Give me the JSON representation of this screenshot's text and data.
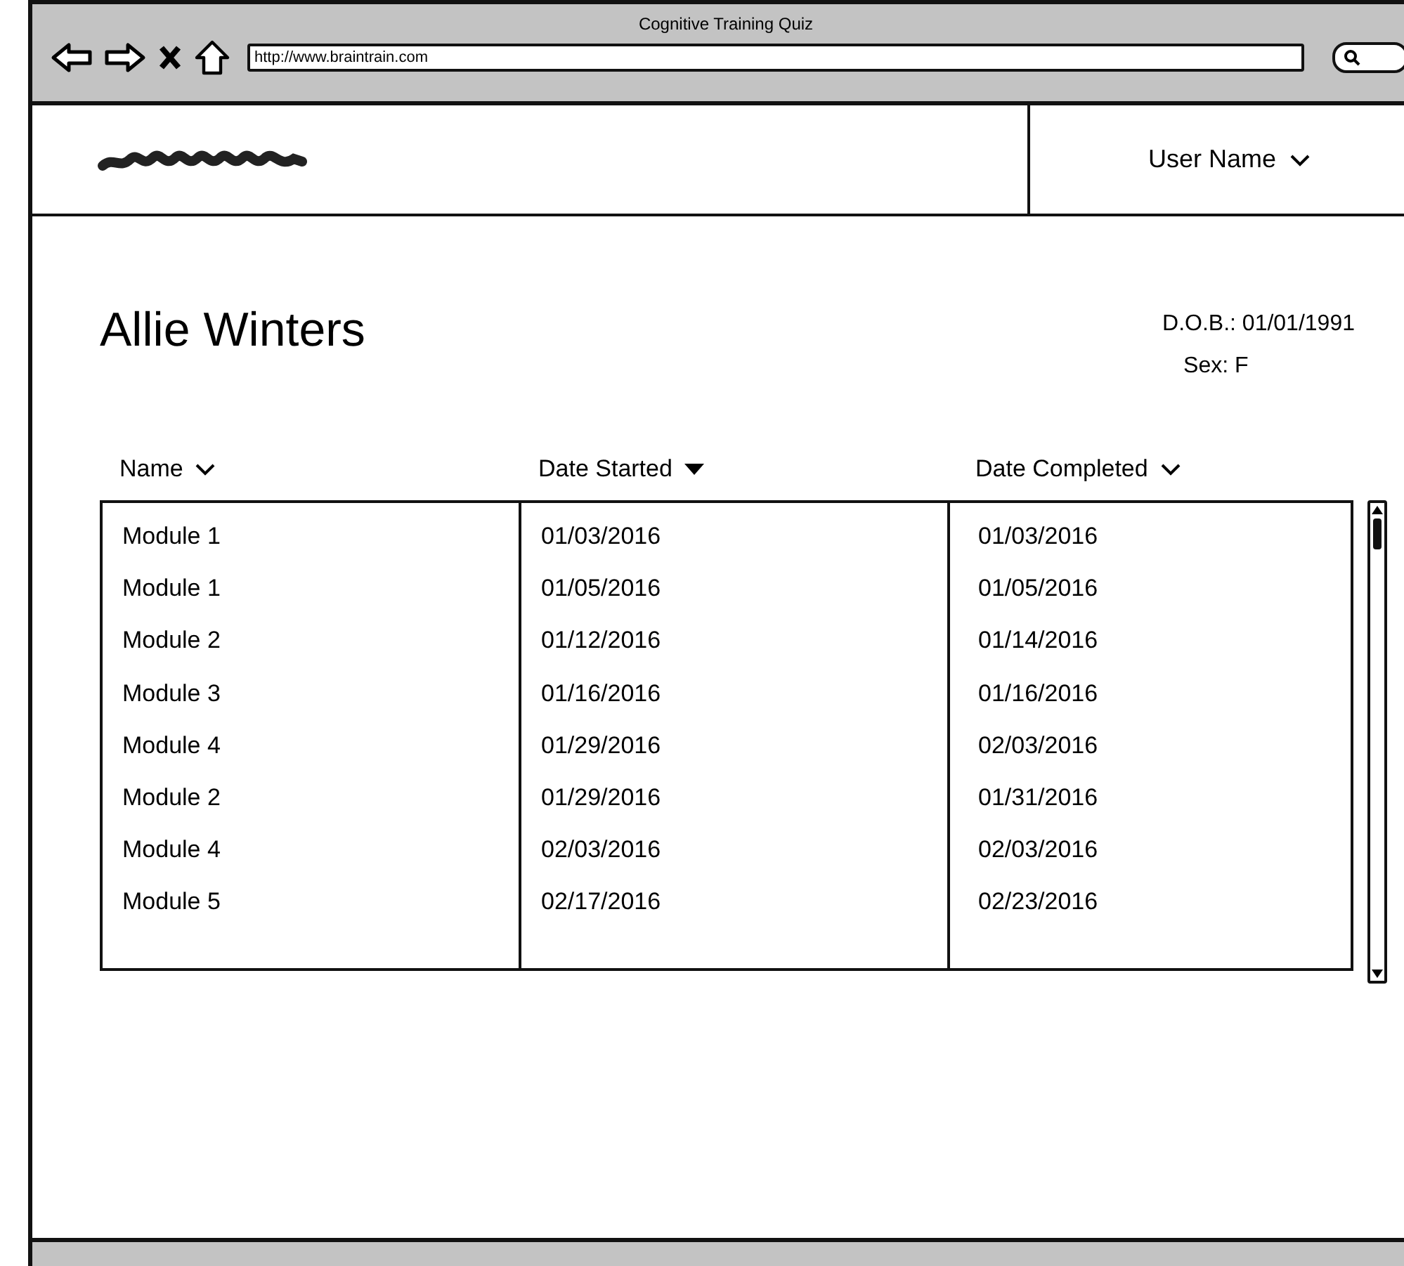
{
  "window": {
    "title": "Cognitive Training Quiz",
    "url": "http://www.braintrain.com"
  },
  "header": {
    "user_menu": "User Name"
  },
  "patient": {
    "name": "Allie Winters",
    "dob": "D.O.B.: 01/01/1991",
    "sex": "Sex: F"
  },
  "table": {
    "columns": [
      {
        "label": "Name",
        "sorted": false
      },
      {
        "label": "Date Started",
        "sorted": true
      },
      {
        "label": "Date Completed",
        "sorted": false
      }
    ],
    "rows": [
      [
        "Module 1",
        "01/03/2016",
        "01/03/2016"
      ],
      [
        "Module 1",
        "01/05/2016",
        "01/05/2016"
      ],
      [
        "Module 2",
        "01/12/2016",
        "01/14/2016"
      ],
      [
        "Module 3",
        "01/16/2016",
        "01/16/2016"
      ],
      [
        "Module 4",
        "01/29/2016",
        "02/03/2016"
      ],
      [
        "Module 2",
        "01/29/2016",
        "01/31/2016"
      ],
      [
        "Module 4",
        "02/03/2016",
        "02/03/2016"
      ],
      [
        "Module 5",
        "02/17/2016",
        "02/23/2016"
      ]
    ]
  }
}
